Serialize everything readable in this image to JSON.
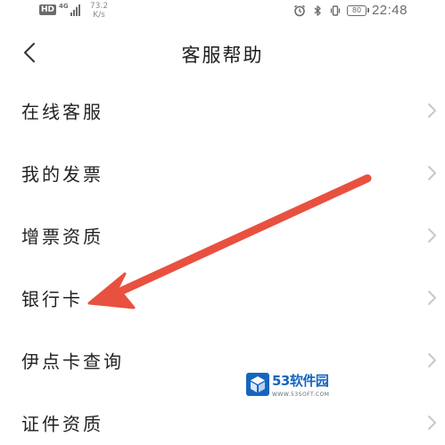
{
  "status_bar": {
    "hd_badge": "HD",
    "network_type": "4G",
    "network_speed_value": "73.2",
    "network_speed_unit": "K/s",
    "battery_level": "80",
    "time": "22:48",
    "icons": [
      "hd-icon",
      "signal-icon",
      "alarm-icon",
      "bluetooth-icon",
      "vibrate-icon",
      "battery-icon"
    ]
  },
  "header": {
    "title": "客服帮助",
    "back_icon": "chevron-left-icon"
  },
  "menu": {
    "items": [
      {
        "label": "在线客服"
      },
      {
        "label": "我的发票"
      },
      {
        "label": "增票资质"
      },
      {
        "label": "银行卡"
      },
      {
        "label": "伊点卡查询"
      },
      {
        "label": "证件资质"
      }
    ],
    "chevron_icon": "chevron-right-icon"
  },
  "annotation": {
    "type": "arrow",
    "color": "#e8513f",
    "points_to": "银行卡"
  },
  "watermark": {
    "name": "53软件园",
    "url": "WWW.53SOFT.COM",
    "color": "#1565c0"
  }
}
